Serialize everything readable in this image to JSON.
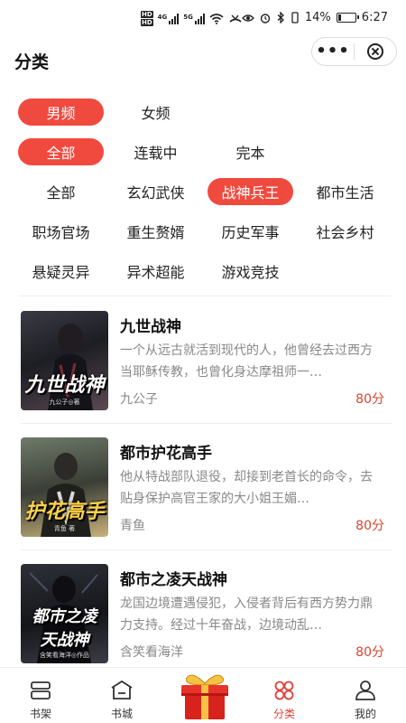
{
  "status_bar": {
    "hd_top": "HD",
    "hd_bottom": "HD",
    "gen1": "4G",
    "gen2": "5G",
    "battery": "14%",
    "time": "6:27"
  },
  "header": {
    "title": "分类",
    "more_label": "•••",
    "icons": [
      "more-icon",
      "close-icon"
    ]
  },
  "filters": {
    "gender": [
      {
        "label": "男频",
        "active": true
      },
      {
        "label": "女频",
        "active": false
      }
    ],
    "status": [
      {
        "label": "全部",
        "active": true
      },
      {
        "label": "连载中",
        "active": false
      },
      {
        "label": "完本",
        "active": false
      }
    ],
    "categories": [
      {
        "label": "全部",
        "active": false
      },
      {
        "label": "玄幻武侠",
        "active": false
      },
      {
        "label": "战神兵王",
        "active": true
      },
      {
        "label": "都市生活",
        "active": false
      },
      {
        "label": "职场官场",
        "active": false
      },
      {
        "label": "重生赘婿",
        "active": false
      },
      {
        "label": "历史军事",
        "active": false
      },
      {
        "label": "社会乡村",
        "active": false
      },
      {
        "label": "悬疑灵异",
        "active": false
      },
      {
        "label": "异术超能",
        "active": false
      },
      {
        "label": "游戏竞技",
        "active": false
      }
    ]
  },
  "books": [
    {
      "title": "九世战神",
      "description": "一个从远古就活到现代的人，他曾经去过西方当耶稣传教，也曾化身达摩祖师一…",
      "author": "九公子",
      "score": "80分",
      "cover_title": "九世战神",
      "cover_sub": "九公子◎著"
    },
    {
      "title": "都市护花高手",
      "description": "他从特战部队退役，却接到老首长的命令，去贴身保护高官王家的大小姐王媚…",
      "author": "青鱼",
      "score": "80分",
      "cover_title": "护花高手",
      "cover_sub": "青鱼 著"
    },
    {
      "title": "都市之凌天战神",
      "description": "龙国边境遭遇侵犯，入侵者背后有西方势力鼎力支持。经过十年奋战，边境动乱…",
      "author": "含笑看海洋",
      "score": "80分",
      "cover_title": "都市之凌天战神",
      "cover_sub": "含笑看海洋◎作品"
    }
  ],
  "tabbar": {
    "tabs": [
      {
        "label": "书架",
        "icon": "bookshelf-icon"
      },
      {
        "label": "书城",
        "icon": "bookstore-icon"
      },
      {
        "label": "分类",
        "icon": "category-icon",
        "active": true
      },
      {
        "label": "我的",
        "icon": "profile-icon"
      }
    ],
    "center": "gift-box-icon"
  },
  "colors": {
    "accent": "#f04a3f",
    "score": "#d9442f",
    "muted_text": "#888888"
  }
}
